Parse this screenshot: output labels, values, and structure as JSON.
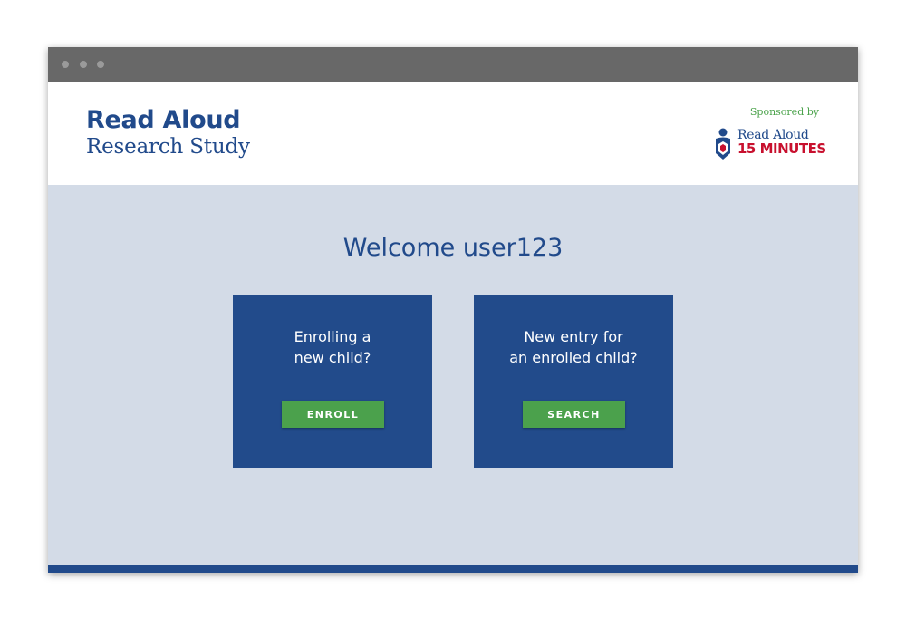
{
  "header": {
    "title_main": "Read Aloud",
    "title_sub": "Research Study",
    "sponsor_label": "Sponsored by",
    "sponsor_logo": {
      "line1": "Read Aloud",
      "line2": "15 MINUTES"
    }
  },
  "main": {
    "welcome": "Welcome user123",
    "cards": [
      {
        "text": "Enrolling a\nnew child?",
        "button_label": "ENROLL"
      },
      {
        "text": "New entry for\nan enrolled child?",
        "button_label": "SEARCH"
      }
    ]
  },
  "colors": {
    "brand_blue": "#214a8b",
    "button_green": "#4ba14c",
    "sponsor_green": "#4aa24a",
    "logo_red": "#c8102e",
    "page_bg": "#d3dbe7"
  }
}
